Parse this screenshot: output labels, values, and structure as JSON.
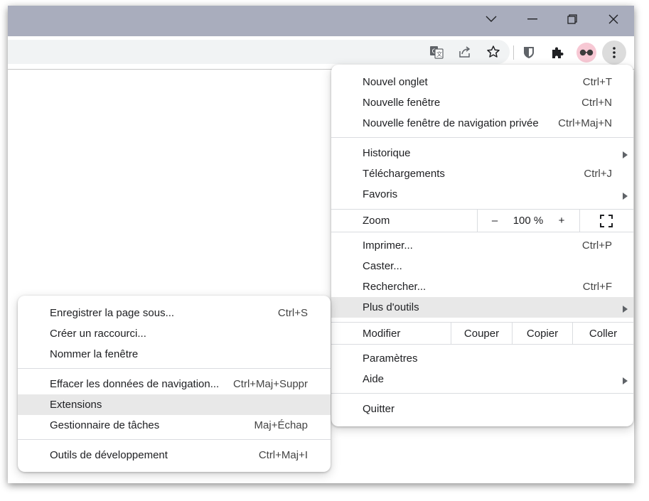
{
  "titlebar": {
    "icons": [
      "chevron-down-icon",
      "minimize-icon",
      "restore-icon",
      "close-icon"
    ]
  },
  "toolbar": {
    "icons": [
      "translate-icon",
      "share-icon",
      "bookmark-star-icon",
      "bitwarden-icon",
      "extensions-puzzle-icon",
      "profile-avatar-icon",
      "more-menu-icon"
    ]
  },
  "main_menu": {
    "new_tab": {
      "label": "Nouvel onglet",
      "accel": "Ctrl+T"
    },
    "new_window": {
      "label": "Nouvelle fenêtre",
      "accel": "Ctrl+N"
    },
    "new_incognito": {
      "label": "Nouvelle fenêtre de navigation privée",
      "accel": "Ctrl+Maj+N"
    },
    "history": {
      "label": "Historique"
    },
    "downloads": {
      "label": "Téléchargements",
      "accel": "Ctrl+J"
    },
    "bookmarks": {
      "label": "Favoris"
    },
    "zoom": {
      "label": "Zoom",
      "minus": "–",
      "value": "100 %",
      "plus": "+"
    },
    "print": {
      "label": "Imprimer...",
      "accel": "Ctrl+P"
    },
    "cast": {
      "label": "Caster..."
    },
    "find": {
      "label": "Rechercher...",
      "accel": "Ctrl+F"
    },
    "more_tools": {
      "label": "Plus d'outils"
    },
    "edit": {
      "label": "Modifier",
      "cut": "Couper",
      "copy": "Copier",
      "paste": "Coller"
    },
    "settings": {
      "label": "Paramètres"
    },
    "help": {
      "label": "Aide"
    },
    "quit": {
      "label": "Quitter"
    }
  },
  "sub_menu": {
    "save_page": {
      "label": "Enregistrer la page sous...",
      "accel": "Ctrl+S"
    },
    "create_shortcut": {
      "label": "Créer un raccourci..."
    },
    "name_window": {
      "label": "Nommer la fenêtre"
    },
    "clear_data": {
      "label": "Effacer les données de navigation...",
      "accel": "Ctrl+Maj+Suppr"
    },
    "extensions": {
      "label": "Extensions"
    },
    "task_manager": {
      "label": "Gestionnaire de tâches",
      "accel": "Maj+Échap"
    },
    "dev_tools": {
      "label": "Outils de développement",
      "accel": "Ctrl+Maj+I"
    }
  },
  "colors": {
    "titlebar": "#a9adbd",
    "highlight": "#e8e8e8",
    "avatar_bg": "#f7c8d4"
  }
}
